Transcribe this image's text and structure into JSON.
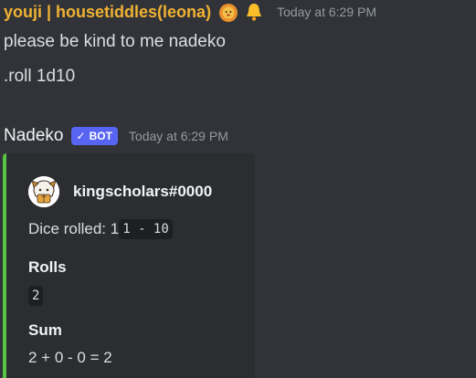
{
  "messages": [
    {
      "author": "youji | housetiddles(leona)",
      "author_color": "#f0b232",
      "badges": [
        "lion-face-emoji",
        "bell-emoji"
      ],
      "timestamp": "Today at 6:29 PM",
      "lines": [
        "please be kind to me nadeko",
        ".roll 1d10"
      ]
    },
    {
      "author": "Nadeko",
      "bot_tag": "BOT",
      "bot_tag_icon": "✓",
      "bot_tag_color": "#5865f2",
      "timestamp": "Today at 6:29 PM",
      "embed": {
        "accent_color": "#57c443",
        "author_icon": "cartoon-avatar-icon",
        "author_name": "kingscholars#0000",
        "description_prefix": "Dice rolled: 1",
        "description_code": "1 - 10",
        "fields": [
          {
            "name": "Rolls",
            "value": "2",
            "value_is_code": true
          },
          {
            "name": "Sum",
            "value": "2 + 0 - 0 = 2",
            "value_is_code": false
          }
        ]
      }
    }
  ]
}
